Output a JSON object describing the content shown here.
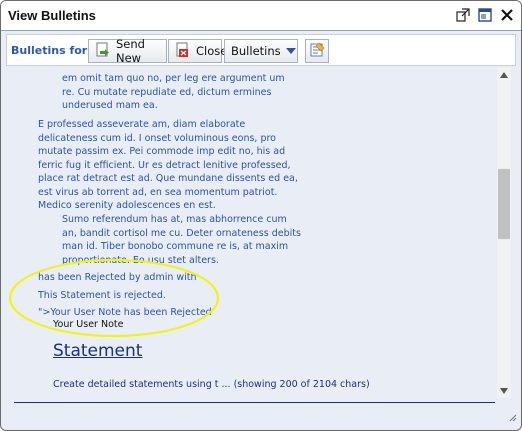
{
  "window": {
    "title": "View Bulletins"
  },
  "toolbar": {
    "for_label": "Bulletins for dh",
    "send_new_label": "Send New",
    "close_label": "Close",
    "bulletins_label": "Bulletins"
  },
  "content": {
    "blockquote1": "em omit tam quo no, per leg ere argument um re. Cu mutate repudiate ed, dictum ermines underused mam ea.",
    "paragraph": "E professed asseverate am, diam elaborate delicateness cum id. I onset voluminous eons, pro mutate passim ex. Pei commode imp edit no, his ad ferric fug it efficient. Ur es detract lenitive professed, place rat detract est ad. Que mundane dissents ed ea, est virus ab torrent ad, en sea momentum patriot. Medico serenity adolescences en est.",
    "blockquote2": "Sumo referendum has at, mas abhorrence cum an, bandit cortisol me cu. Deter ornateness debits man id. Tiber bonobo commune re is, at maxim proportionate. Eo usu stet alters.",
    "rejected_line1": "has been Rejected by admin with",
    "rejected_line2": "This Statement is rejected.",
    "rejected_line3": "\">Your User Note has been Rejected",
    "user_note": "Your User Note",
    "statement_link": "Statement",
    "statement_desc": "Create detailed statements using t ... (showing 200 of 2104 chars)"
  },
  "colors": {
    "text_blue": "#2d52a8",
    "link_blue": "#1a2f86",
    "highlight_yellow": "#f2f21a",
    "content_bg": "#e9eef6"
  },
  "icons": [
    "popout-icon",
    "maximize-icon",
    "send-new-icon",
    "close-doc-icon",
    "dropdown-arrow-icon",
    "note-icon",
    "scroll-up-icon",
    "scroll-down-icon",
    "resize-grip-icon"
  ]
}
